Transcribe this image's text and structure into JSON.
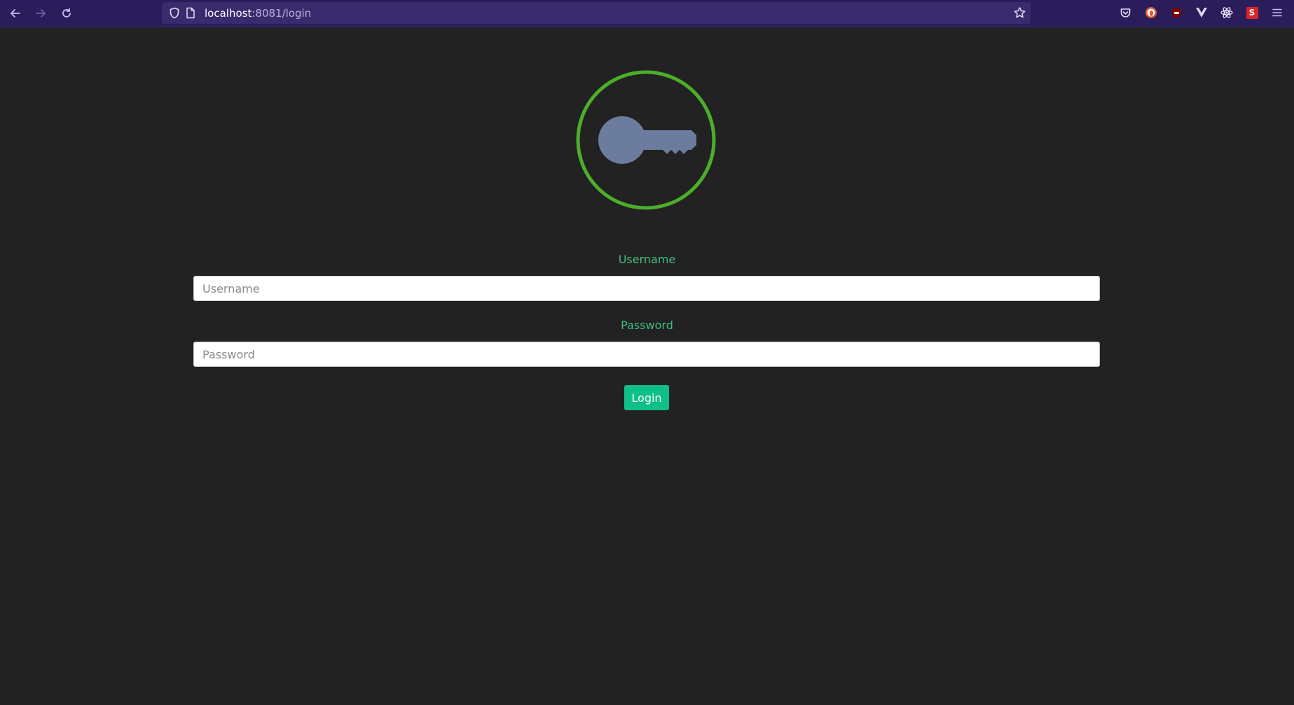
{
  "browser": {
    "url_host": "localhost",
    "url_rest": ":8081/login",
    "back_icon": "arrow-left-icon",
    "forward_icon": "arrow-right-icon",
    "reload_icon": "reload-icon",
    "extensions": [
      "pocket-icon",
      "duckduckgo-icon",
      "ublock-icon",
      "vue-devtools-icon",
      "react-devtools-icon",
      "s-extension-icon",
      "menu-icon"
    ],
    "s_extension_label": "S"
  },
  "logo": {
    "icon": "key-icon",
    "ring_color": "#4caf2a",
    "key_color": "#6b7c9e"
  },
  "form": {
    "username_label": "Username",
    "username_placeholder": "Username",
    "username_value": "",
    "password_label": "Password",
    "password_placeholder": "Password",
    "password_value": "",
    "login_label": "Login"
  },
  "colors": {
    "accent": "#0fbf8a",
    "label": "#3fbf7f",
    "background": "#222222",
    "toolbar": "#2b1d5c"
  }
}
